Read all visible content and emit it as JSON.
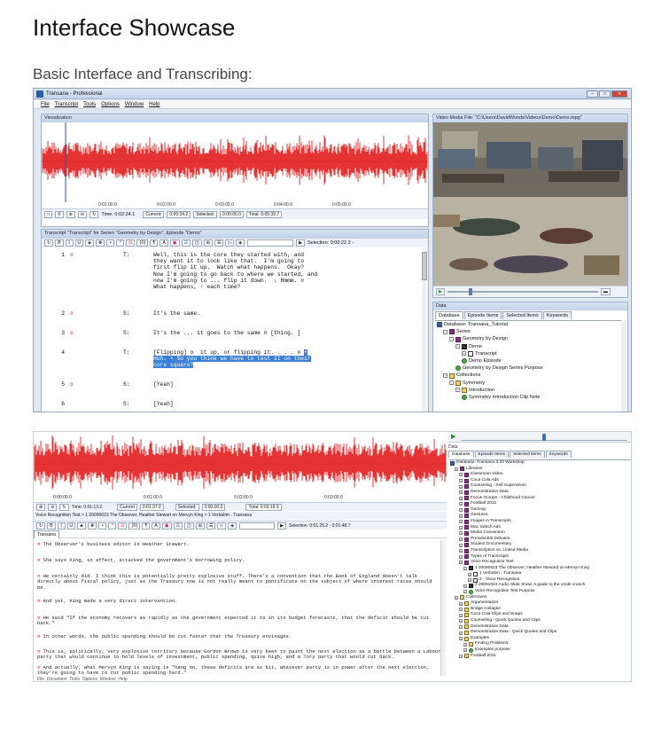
{
  "page": {
    "title": "Interface Showcase",
    "subtitle": "Basic Interface and Transcribing:"
  },
  "ss1": {
    "window_title": "Transana - Professional",
    "menu": [
      "File",
      "Transcript",
      "Tools",
      "Options",
      "Window",
      "Help"
    ],
    "visualization": {
      "header": "Visualization",
      "ticks": [
        "0:01:00.0",
        "0:02:00.0",
        "0:03:00.0",
        "0:04:00.0",
        "0:05:00.0"
      ],
      "time_label": "Time: 0:02:24.1",
      "current_btn": "Current:",
      "current_val": "0:00:24.2",
      "selected_btn": "Selected:",
      "selected_val": "0:00:00.0",
      "total": "Total: 0:05:39.7"
    },
    "video": {
      "header": "Video Media File: \"C:\\Users\\DavidWoods\\Videos\\Demo\\Demo.mpg\""
    },
    "transcript": {
      "header": "Transcript \"Transcript\" for Series \"Geometry by Design\", Episode \"Demo\"",
      "selection": "Selection: 0:00:22.3 -",
      "toolbar_buttons": [
        "↻",
        "B",
        "I",
        "U",
        "◈",
        "✥",
        "•",
        "°",
        "⊡",
        "(©)",
        "¶",
        "A",
        "▣",
        "☲",
        "◫",
        "⊞",
        "☰",
        "▷",
        "◈"
      ],
      "rows": [
        {
          "num": "1",
          "mark": "¤",
          "speaker": "T:",
          "lines": [
            "Well, this is the core they started with, and",
            "they want it to look like that.  I'm going to",
            "first flip it up.  Watch what happens.  Okay?",
            "Now I'm going to go back to where we started, and",
            "now I'm going to ... flip it down.  ↓ Hmmm. ¤",
            "What happens, ↑ each time?"
          ]
        },
        {
          "num": "2",
          "mark": "¤",
          "speaker": "S:",
          "lines": [
            "It's the same."
          ]
        },
        {
          "num": "3",
          "mark": "¤",
          "speaker": "S:",
          "lines": [
            "It's the ... it goes to the same ¤ [thing. ]"
          ]
        },
        {
          "num": "4",
          "mark": "",
          "speaker": "T:",
          "lines": [
            "[Flipping] ¤  it up, or flipping it. . . . ¤ "
          ],
          "hl": [
            "Huh. • So you think we have to test it on their",
            "core square?"
          ],
          "hl_lead": "•"
        },
        {
          "num": "5",
          "mark": "¤",
          "speaker": "S:",
          "lines": [
            "[Yeah]"
          ]
        },
        {
          "num": "6",
          "mark": "",
          "speaker": "S:",
          "lines": [
            "[Yeah]"
          ]
        }
      ]
    },
    "data": {
      "header": "Data",
      "tabs": [
        "Database",
        "Episode Items",
        "Selected Items",
        "Keywords"
      ],
      "tree": [
        {
          "t": "Database: Transana_Tutorial",
          "i": "db",
          "d": 0,
          "pm": ""
        },
        {
          "t": "Series",
          "i": "ser",
          "d": 1,
          "pm": "−"
        },
        {
          "t": "Geometry by Design",
          "i": "ser",
          "d": 2,
          "pm": "−"
        },
        {
          "t": "Demo",
          "i": "bk",
          "d": 3,
          "pm": "−"
        },
        {
          "t": "Transcript",
          "i": "tr",
          "d": 4,
          "pm": "+"
        },
        {
          "t": "Demo Episode",
          "i": "gr",
          "d": 4,
          "pm": ""
        },
        {
          "t": "Geometry by Design Series Purpose",
          "i": "gr",
          "d": 3,
          "pm": ""
        },
        {
          "t": "Collections",
          "i": "col",
          "d": 1,
          "pm": "−"
        },
        {
          "t": "Symmetry",
          "i": "col",
          "d": 2,
          "pm": "−"
        },
        {
          "t": "Introduction",
          "i": "col",
          "d": 3,
          "pm": "−"
        },
        {
          "t": "Symmetry Introduction Clip Note",
          "i": "gr",
          "d": 4,
          "pm": ""
        }
      ]
    }
  },
  "ss2": {
    "ticks": [
      "0:00:00.0",
      "0:01:00.0",
      "0:02:00.0",
      "0:03:00.0"
    ],
    "time_label": "Time: 0:01:13.2",
    "current_btn": "Current",
    "current_val": "0:01:37.0",
    "selected_btn": "Selected:",
    "selected_val": "0:00:00.0",
    "total": "Total: 0:03:19.9",
    "transcript_header": "Voice Recognition Test > 1 20090623 The Observer, Heather Stewart on Mervyn King > 1 Verbatim - Transana",
    "selection": "Selection: 0:01:25.2 - 0:01:48.7",
    "tab_label": "Transana",
    "lines": [
      "The Observer's business editor is Heather Stewart.",
      "She says King, in effect, attacked the government's borrowing policy.",
      "He certainly did. I think this is potentially pretty explosive stuff.  There's a convention that the Bank of England doesn't talk directly about fiscal policy, just as the Treasury now is not really meant to pontificate on the subject of where interest rates should be.",
      "And yet, King made a very direct intervention.",
      "He said \"If the economy recovers as rapidly as the government expected it to in its budget forecasts, that the deficit should be cut back.\"",
      "In other words, the public spending should be cut faster that the Treasury envisages.",
      "This is, politically, very explosive territory because Gordon Brown is very keen to paint the next election as a battle between a Labour party that would continue to hold levels of investment, public spending, quite high, and a Tory party that would cut back.",
      "And actually, what Mervyn King is saying is \"hang on, these deficits are so bit, whatever party is in power after the next election, they're going to have to cut public spending hard.\""
    ],
    "bottom_menu": "File  Document  Tools  Options  Window  Help",
    "data_header": "Data",
    "tabs": [
      "Database",
      "Episode Items",
      "Selected Items",
      "Keywords"
    ],
    "tree": [
      {
        "t": "Database: Transana 3.20 Workshop",
        "i": "db",
        "d": 0
      },
      {
        "t": "Libraries",
        "i": "ser",
        "d": 1
      },
      {
        "t": "Classroom Video",
        "i": "ser",
        "d": 2
      },
      {
        "t": "Coca Cola Ads",
        "i": "ser",
        "d": 2
      },
      {
        "t": "Counseling - Self Supervision",
        "i": "ser",
        "d": 2
      },
      {
        "t": "Demonstration Data",
        "i": "ser",
        "d": 2
      },
      {
        "t": "Focus Groups - Childhood Cancer",
        "i": "ser",
        "d": 2
      },
      {
        "t": "Football 2012",
        "i": "ser",
        "d": 2
      },
      {
        "t": "Gaming",
        "i": "ser",
        "d": 2
      },
      {
        "t": "Gestures",
        "i": "ser",
        "d": 2
      },
      {
        "t": "Images in Transcripts",
        "i": "ser",
        "d": 2
      },
      {
        "t": "Mac Switch Ads",
        "i": "ser",
        "d": 2
      },
      {
        "t": "Media Conversion",
        "i": "ser",
        "d": 2
      },
      {
        "t": "Presidential Debates",
        "i": "ser",
        "d": 2
      },
      {
        "t": "Student Documentary",
        "i": "ser",
        "d": 2
      },
      {
        "t": "Transcription vs. Linked Media",
        "i": "ser",
        "d": 2
      },
      {
        "t": "Types of Transcripts",
        "i": "ser",
        "d": 2
      },
      {
        "t": "Voice Recognition Test",
        "i": "ser",
        "d": 2
      },
      {
        "t": "1 20090623 The Observer, Heather Steward on Mervyn King",
        "i": "bk",
        "d": 3
      },
      {
        "t": "1 Verbatim - Transana",
        "i": "tr",
        "d": 4
      },
      {
        "t": "2 - Voice Recognition",
        "i": "tr",
        "d": 4
      },
      {
        "t": "2 20091024 Audio Slide Show, A guide to the credit crunch",
        "i": "bk",
        "d": 3
      },
      {
        "t": "Voice Recognition Test Purpose",
        "i": "gr",
        "d": 3
      },
      {
        "t": "Collections",
        "i": "col",
        "d": 1
      },
      {
        "t": "Argumentation",
        "i": "col",
        "d": 2
      },
      {
        "t": "Bridge Collapse",
        "i": "col",
        "d": 2
      },
      {
        "t": "Coca Cola Clips and Snaps",
        "i": "col",
        "d": 2
      },
      {
        "t": "Counseling - Quick Quotes and Clips",
        "i": "col",
        "d": 2
      },
      {
        "t": "Demonstration Data",
        "i": "col",
        "d": 2
      },
      {
        "t": "Demonstration Data - Quick Quotes and Clips",
        "i": "col",
        "d": 2
      },
      {
        "t": "Examples",
        "i": "col",
        "d": 2
      },
      {
        "t": "Finding Problems",
        "i": "col",
        "d": 3
      },
      {
        "t": "Examples purpose",
        "i": "gr",
        "d": 3
      },
      {
        "t": "Football 2011",
        "i": "col",
        "d": 2
      }
    ]
  },
  "colors": {
    "wave": "#e31c1c",
    "accent": "#3d80d8",
    "panel_head": "#c9d8ec"
  }
}
